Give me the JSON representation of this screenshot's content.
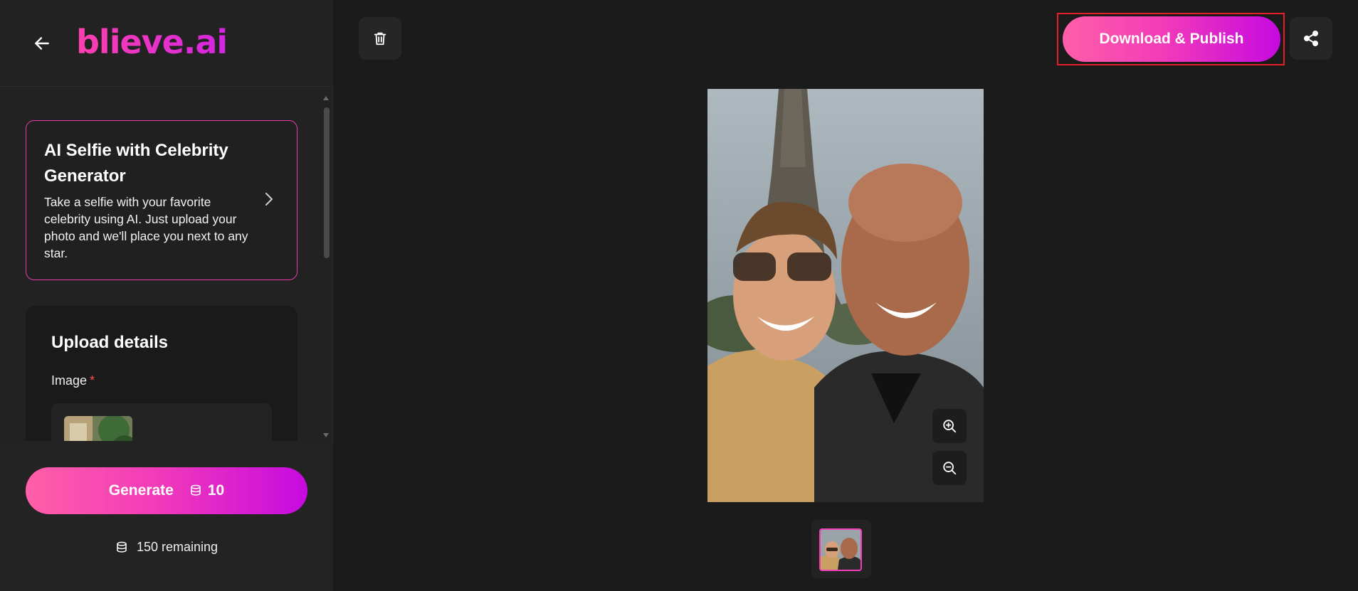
{
  "sidebar": {
    "logo_text": "blieve.ai",
    "tool_card": {
      "title": "AI Selfie with Celebrity Generator",
      "description": "Take a selfie with your favorite celebrity using AI. Just upload your photo and we'll place you next to any star."
    },
    "upload": {
      "title": "Upload details",
      "image_label": "Image",
      "required_mark": "*"
    },
    "generate": {
      "label": "Generate",
      "cost": "10"
    },
    "remaining": "150 remaining"
  },
  "toolbar": {
    "download_label": "Download & Publish"
  },
  "icons": {
    "back": "arrow-left-icon",
    "trash": "trash-icon",
    "share": "share-icon",
    "zoom_in": "zoom-in-icon",
    "zoom_out": "zoom-out-icon",
    "coin": "coins-stack-icon",
    "chevron": "chevron-right-icon"
  },
  "colors": {
    "accent_start": "#ff5fa8",
    "accent_end": "#c60ae0",
    "highlight_border": "#e3202a",
    "required": "#ff4b4b"
  }
}
